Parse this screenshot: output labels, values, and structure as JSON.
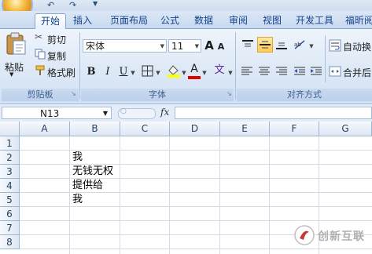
{
  "quick_access": {
    "undo": "↶",
    "redo": "↷"
  },
  "tabs": [
    {
      "label": "开始",
      "active": true
    },
    {
      "label": "插入"
    },
    {
      "label": "页面布局"
    },
    {
      "label": "公式"
    },
    {
      "label": "数据"
    },
    {
      "label": "审阅"
    },
    {
      "label": "视图"
    },
    {
      "label": "开发工具"
    },
    {
      "label": "福昕阅"
    }
  ],
  "clipboard": {
    "paste": "粘贴",
    "cut": "剪切",
    "copy": "复制",
    "format_painter": "格式刷",
    "group_label": "剪贴板"
  },
  "font": {
    "name": "宋体",
    "size": "11",
    "bold": "B",
    "italic": "I",
    "underline": "U",
    "grow": "A",
    "shrink": "A",
    "font_color": "A",
    "wen": "文",
    "group_label": "字体"
  },
  "alignment": {
    "wrap_text": "自动换",
    "merge_center": "合并后",
    "group_label": "对齐方式"
  },
  "formula_bar": {
    "name_box": "N13",
    "fx": "fx",
    "value": ""
  },
  "columns": [
    "A",
    "B",
    "C",
    "D",
    "E",
    "F",
    "G"
  ],
  "rows": [
    "1",
    "2",
    "3",
    "4",
    "5",
    "6",
    "7",
    "8"
  ],
  "cells": [
    {
      "ref": "B2",
      "value": "我"
    },
    {
      "ref": "B3",
      "value": "无钱无权"
    },
    {
      "ref": "B4",
      "value": "提供给"
    },
    {
      "ref": "B5",
      "value": "我"
    }
  ],
  "watermark": {
    "text": "创新互联"
  },
  "colors": {
    "ribbon": "#dce8f6",
    "tab_text": "#15428b",
    "font_color_bar": "#e00000",
    "highlight_bar": "#ffff00"
  }
}
